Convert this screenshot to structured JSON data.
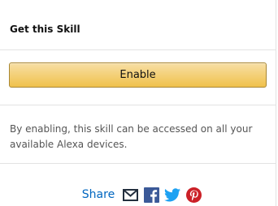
{
  "panel": {
    "title": "Get this Skill"
  },
  "enable": {
    "button_label": "Enable"
  },
  "disclaimer": {
    "text": "By enabling, this skill can be accessed on all your available Alexa devices."
  },
  "share": {
    "label": "Share",
    "icons": [
      "email-icon",
      "facebook-icon",
      "twitter-icon",
      "pinterest-icon"
    ],
    "colors": {
      "link": "#0066c0",
      "email": "#232f3e",
      "facebook": "#3b5998",
      "twitter": "#1da1f2",
      "pinterest": "#cb2027"
    }
  },
  "colors": {
    "button_top": "#f7dfa5",
    "button_bottom": "#f0c14b",
    "button_border": "#a88734",
    "divider": "#e3e3e3"
  }
}
